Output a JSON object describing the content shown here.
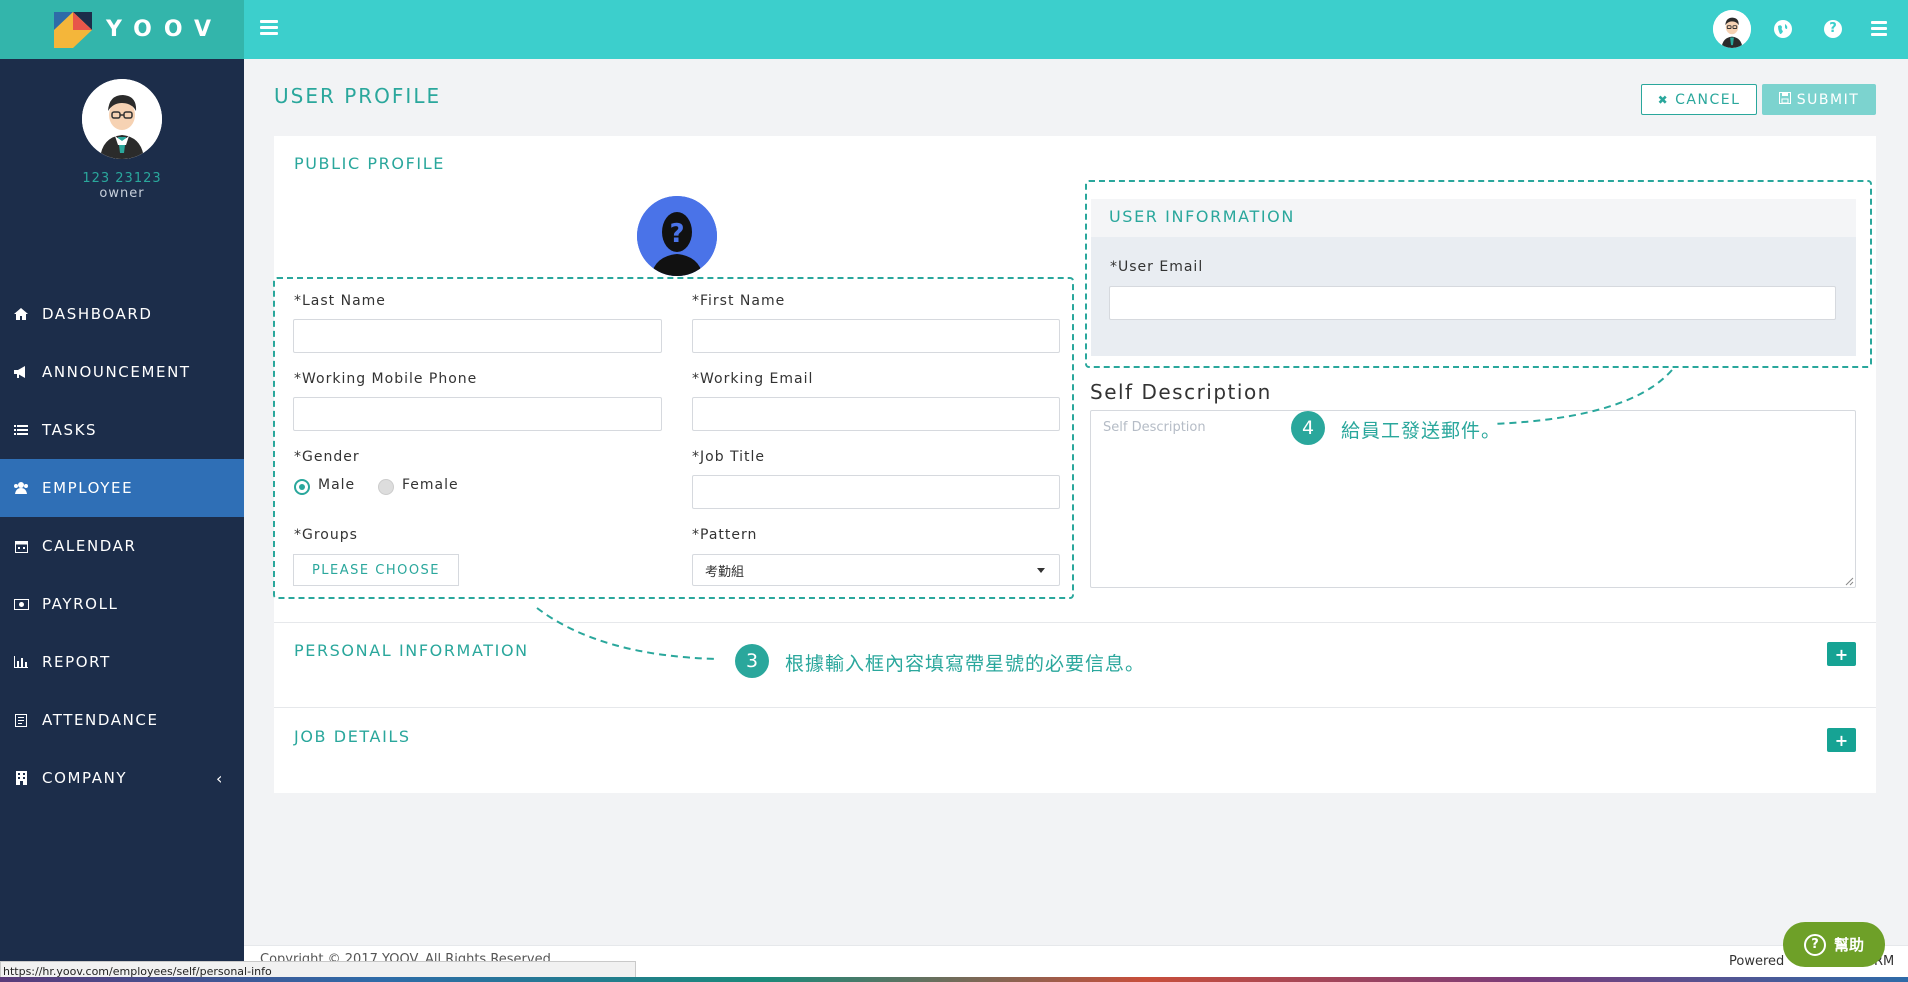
{
  "brand": {
    "name": "YOOV"
  },
  "user": {
    "name": "123 23123",
    "role": "owner"
  },
  "sidebar": {
    "items": [
      {
        "label": "DASHBOARD",
        "icon": "home-icon"
      },
      {
        "label": "ANNOUNCEMENT",
        "icon": "bullhorn-icon"
      },
      {
        "label": "TASKS",
        "icon": "list-icon"
      },
      {
        "label": "EMPLOYEE",
        "icon": "users-icon",
        "active": true
      },
      {
        "label": "CALENDAR",
        "icon": "calendar-icon"
      },
      {
        "label": "PAYROLL",
        "icon": "money-icon"
      },
      {
        "label": "REPORT",
        "icon": "bar-chart-icon"
      },
      {
        "label": "ATTENDANCE",
        "icon": "attendance-icon"
      },
      {
        "label": "COMPANY",
        "icon": "building-icon",
        "chevron": "‹"
      }
    ]
  },
  "topbar": {
    "globe_icon": "globe-icon",
    "help_icon": "question-circle-icon",
    "help_glyph": "?"
  },
  "page": {
    "title": "USER PROFILE",
    "cancel_label": "CANCEL",
    "submit_label": "SUBMIT",
    "cancel_icon": "✖",
    "submit_icon": "🖫"
  },
  "public_profile": {
    "title": "PUBLIC PROFILE",
    "last_name_label": "*Last Name",
    "first_name_label": "*First Name",
    "mobile_label": "*Working Mobile Phone",
    "work_email_label": "*Working Email",
    "gender_label": "*Gender",
    "gender_options": [
      "Male",
      "Female"
    ],
    "gender_selected": "Male",
    "job_title_label": "*Job Title",
    "groups_label": "*Groups",
    "groups_button": "PLEASE CHOOSE",
    "pattern_label": "*Pattern",
    "pattern_value": "考勤組"
  },
  "user_information": {
    "title": "USER INFORMATION",
    "email_label": "*User Email"
  },
  "self_description": {
    "title": "Self Description",
    "placeholder": "Self Description"
  },
  "sections": {
    "personal_info": "PERSONAL INFORMATION",
    "job_details": "JOB DETAILS",
    "expand_glyph": "+"
  },
  "annotations": {
    "step3_num": "3",
    "step3_text": "根據輸入框內容填寫帶星號的必要信息。",
    "step4_num": "4",
    "step4_text": "給員工發送郵件。"
  },
  "footer": {
    "copyright": "Copyright © 2017 YOOV. All Rights Reserved.",
    "powered": "Powered",
    "tail": "RM"
  },
  "status_bar": {
    "url": "https://hr.yoov.com/employees/self/personal-info"
  },
  "help_widget": {
    "label": "幫助",
    "glyph": "?"
  },
  "colors": {
    "accent": "#2aa79c",
    "topbar": "#3ccfcc",
    "sidebar": "#1c2d4a",
    "active": "#2f6fb6",
    "help": "#6ea028"
  }
}
